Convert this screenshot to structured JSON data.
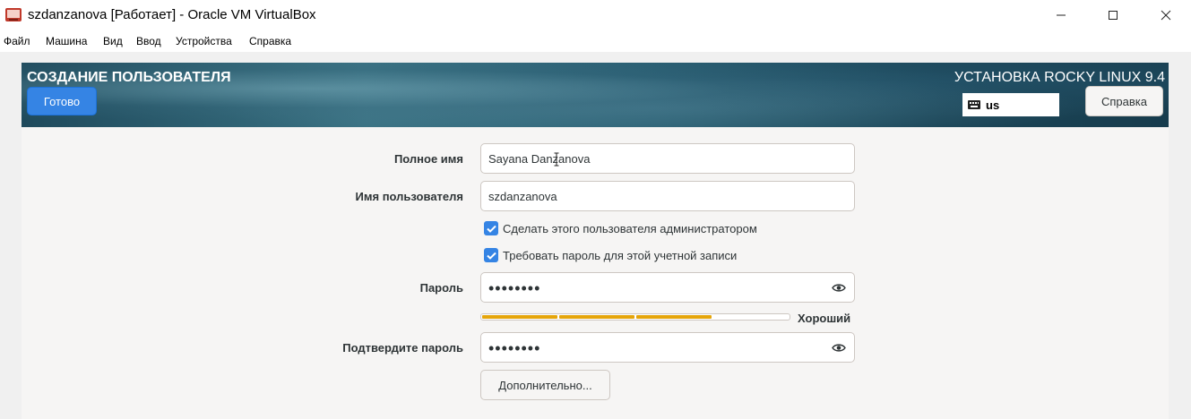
{
  "window": {
    "title": "szdanzanova [Работает] - Oracle VM VirtualBox",
    "app_icon": "virtualbox-icon"
  },
  "menubar": {
    "items": [
      "Файл",
      "Машина",
      "Вид",
      "Ввод",
      "Устройства",
      "Справка"
    ]
  },
  "header": {
    "title": "СОЗДАНИЕ ПОЛЬЗОВАТЕЛЯ",
    "done_label": "Готово",
    "product_title": "УСТАНОВКА ROCKY LINUX 9.4",
    "keyboard_layout": "us",
    "help_label": "Справка"
  },
  "form": {
    "full_name_label": "Полное имя",
    "full_name_value": "Sayana Danzanova",
    "username_label": "Имя пользователя",
    "username_value": "szdanzanova",
    "admin_checkbox_label": "Сделать этого пользователя администратором",
    "admin_checked": true,
    "require_password_label": "Требовать пароль для этой учетной записи",
    "require_password_checked": true,
    "password_label": "Пароль",
    "password_value": "••••••••",
    "strength_level": 0.75,
    "strength_label": "Хороший",
    "confirm_label": "Подтвердите пароль",
    "confirm_value": "••••••••",
    "advanced_label": "Дополнительно..."
  },
  "colors": {
    "accent": "#3584e4",
    "strength_fill": "#e5a50a",
    "header_bg": "#2a5f72"
  }
}
